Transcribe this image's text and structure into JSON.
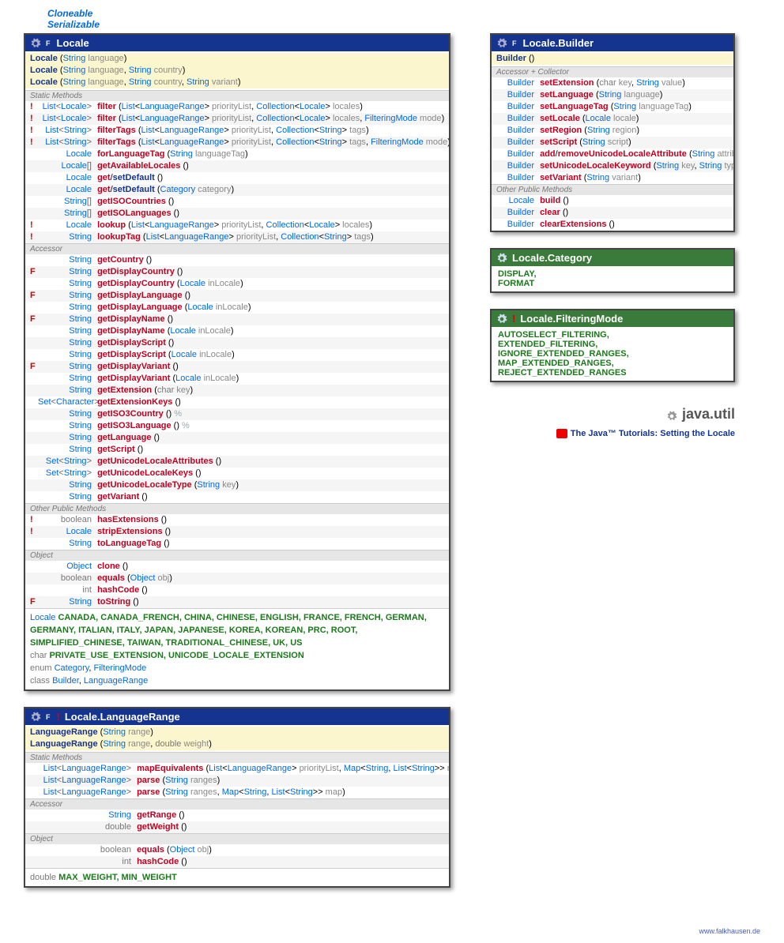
{
  "topLinks": [
    "Cloneable",
    "Serializable"
  ],
  "locale": {
    "title": "Locale",
    "flag": "F",
    "ctors": [
      {
        "html": "<span class='mb'>Locale</span> (<span class='t'>String</span> <span class='p'>language</span>)"
      },
      {
        "html": "<span class='mb'>Locale</span> (<span class='t'>String</span> <span class='p'>language</span>, <span class='t'>String</span> <span class='p'>country</span>)"
      },
      {
        "html": "<span class='mb'>Locale</span> (<span class='t'>String</span> <span class='p'>language</span>, <span class='t'>String</span> <span class='p'>country</span>, <span class='t'>String</span> <span class='p'>variant</span>)"
      }
    ],
    "static": {
      "label": "Static Methods",
      "rows": [
        {
          "mk": "!",
          "ret": "<span class='t'>List</span>&lt;<span class='t'>Locale</span>&gt;",
          "sig": "<span class='m'>filter</span> (<span class='t'>List</span>&lt;<span class='t'>LanguageRange</span>&gt; <span class='p'>priorityList</span>, <span class='t'>Collection</span>&lt;<span class='t'>Locale</span>&gt; <span class='p'>locales</span>)"
        },
        {
          "mk": "!",
          "ret": "<span class='t'>List</span>&lt;<span class='t'>Locale</span>&gt;",
          "sig": "<span class='m'>filter</span> (<span class='t'>List</span>&lt;<span class='t'>LanguageRange</span>&gt; <span class='p'>priorityList</span>, <span class='t'>Collection</span>&lt;<span class='t'>Locale</span>&gt; <span class='p'>locales</span>, <span class='t'>FilteringMode</span> <span class='p'>mode</span>)"
        },
        {
          "mk": "!",
          "ret": "<span class='t'>List</span>&lt;<span class='t'>String</span>&gt;",
          "sig": "<span class='m'>filterTags</span> (<span class='t'>List</span>&lt;<span class='t'>LanguageRange</span>&gt; <span class='p'>priorityList</span>, <span class='t'>Collection</span>&lt;<span class='t'>String</span>&gt; <span class='p'>tags</span>)"
        },
        {
          "mk": "!",
          "ret": "<span class='t'>List</span>&lt;<span class='t'>String</span>&gt;",
          "sig": "<span class='m'>filterTags</span> (<span class='t'>List</span>&lt;<span class='t'>LanguageRange</span>&gt; <span class='p'>priorityList</span>, <span class='t'>Collection</span>&lt;<span class='t'>String</span>&gt; <span class='p'>tags</span>, <span class='t'>FilteringMode</span> <span class='p'>mode</span>)"
        },
        {
          "mk": "",
          "ret": "<span class='t'>Locale</span>",
          "sig": "<span class='m'>forLanguageTag</span> (<span class='t'>String</span> <span class='p'>languageTag</span>)"
        },
        {
          "mk": "",
          "ret": "<span class='t'>Locale</span>[]",
          "sig": "<span class='m'>getAvailableLocales</span> ()"
        },
        {
          "mk": "",
          "ret": "<span class='t'>Locale</span>",
          "sig": "<span class='m'>get</span>/<span class='mb'>setDefault</span> ()"
        },
        {
          "mk": "",
          "ret": "<span class='t'>Locale</span>",
          "sig": "<span class='m'>get</span>/<span class='mb'>setDefault</span> (<span class='t'>Category</span> <span class='p'>category</span>)"
        },
        {
          "mk": "",
          "ret": "<span class='t'>String</span>[]",
          "sig": "<span class='m'>getISOCountries</span> ()"
        },
        {
          "mk": "",
          "ret": "<span class='t'>String</span>[]",
          "sig": "<span class='m'>getISOLanguages</span> ()"
        },
        {
          "mk": "!",
          "ret": "<span class='t'>Locale</span>",
          "sig": "<span class='m'>lookup</span> (<span class='t'>List</span>&lt;<span class='t'>LanguageRange</span>&gt; <span class='p'>priorityList</span>, <span class='t'>Collection</span>&lt;<span class='t'>Locale</span>&gt; <span class='p'>locales</span>)"
        },
        {
          "mk": "!",
          "ret": "<span class='t'>String</span>",
          "sig": "<span class='m'>lookupTag</span> (<span class='t'>List</span>&lt;<span class='t'>LanguageRange</span>&gt; <span class='p'>priorityList</span>, <span class='t'>Collection</span>&lt;<span class='t'>String</span>&gt; <span class='p'>tags</span>)"
        }
      ]
    },
    "accessor": {
      "label": "Accessor",
      "rows": [
        {
          "mk": "",
          "ret": "<span class='t'>String</span>",
          "sig": "<span class='m'>getCountry</span> ()"
        },
        {
          "mk": "F",
          "ret": "<span class='t'>String</span>",
          "sig": "<span class='m'>getDisplayCountry</span> ()"
        },
        {
          "mk": "",
          "ret": "<span class='t'>String</span>",
          "sig": "<span class='m'>getDisplayCountry</span> (<span class='t'>Locale</span> <span class='p'>inLocale</span>)"
        },
        {
          "mk": "F",
          "ret": "<span class='t'>String</span>",
          "sig": "<span class='m'>getDisplayLanguage</span> ()"
        },
        {
          "mk": "",
          "ret": "<span class='t'>String</span>",
          "sig": "<span class='m'>getDisplayLanguage</span> (<span class='t'>Locale</span> <span class='p'>inLocale</span>)"
        },
        {
          "mk": "F",
          "ret": "<span class='t'>String</span>",
          "sig": "<span class='m'>getDisplayName</span> ()"
        },
        {
          "mk": "",
          "ret": "<span class='t'>String</span>",
          "sig": "<span class='m'>getDisplayName</span> (<span class='t'>Locale</span> <span class='p'>inLocale</span>)"
        },
        {
          "mk": "",
          "ret": "<span class='t'>String</span>",
          "sig": "<span class='m'>getDisplayScript</span> ()"
        },
        {
          "mk": "",
          "ret": "<span class='t'>String</span>",
          "sig": "<span class='m'>getDisplayScript</span> (<span class='t'>Locale</span> <span class='p'>inLocale</span>)"
        },
        {
          "mk": "F",
          "ret": "<span class='t'>String</span>",
          "sig": "<span class='m'>getDisplayVariant</span> ()"
        },
        {
          "mk": "",
          "ret": "<span class='t'>String</span>",
          "sig": "<span class='m'>getDisplayVariant</span> (<span class='t'>Locale</span> <span class='p'>inLocale</span>)"
        },
        {
          "mk": "",
          "ret": "<span class='t'>String</span>",
          "sig": "<span class='m'>getExtension</span> (<span class='kw'>char</span> <span class='p'>key</span>)"
        },
        {
          "mk": "",
          "ret": "<span class='t'>Set</span>&lt;<span class='t'>Character</span>&gt;",
          "sig": "<span class='m'>getExtensionKeys</span> ()"
        },
        {
          "mk": "",
          "ret": "<span class='t'>String</span>",
          "sig": "<span class='m'>getISO3Country</span> () <span class='pc'>%</span>"
        },
        {
          "mk": "",
          "ret": "<span class='t'>String</span>",
          "sig": "<span class='m'>getISO3Language</span> () <span class='pc'>%</span>"
        },
        {
          "mk": "",
          "ret": "<span class='t'>String</span>",
          "sig": "<span class='m'>getLanguage</span> ()"
        },
        {
          "mk": "",
          "ret": "<span class='t'>String</span>",
          "sig": "<span class='m'>getScript</span> ()"
        },
        {
          "mk": "",
          "ret": "<span class='t'>Set</span>&lt;<span class='t'>String</span>&gt;",
          "sig": "<span class='m'>getUnicodeLocaleAttributes</span> ()"
        },
        {
          "mk": "",
          "ret": "<span class='t'>Set</span>&lt;<span class='t'>String</span>&gt;",
          "sig": "<span class='m'>getUnicodeLocaleKeys</span> ()"
        },
        {
          "mk": "",
          "ret": "<span class='t'>String</span>",
          "sig": "<span class='m'>getUnicodeLocaleType</span> (<span class='t'>String</span> <span class='p'>key</span>)"
        },
        {
          "mk": "",
          "ret": "<span class='t'>String</span>",
          "sig": "<span class='m'>getVariant</span> ()"
        }
      ]
    },
    "other": {
      "label": "Other Public Methods",
      "rows": [
        {
          "mk": "!",
          "ret": "<span class='kw'>boolean</span>",
          "sig": "<span class='m'>hasExtensions</span> ()"
        },
        {
          "mk": "!",
          "ret": "<span class='t'>Locale</span>",
          "sig": "<span class='m'>stripExtensions</span> ()"
        },
        {
          "mk": "",
          "ret": "<span class='t'>String</span>",
          "sig": "<span class='m'>toLanguageTag</span> ()"
        }
      ]
    },
    "object": {
      "label": "Object",
      "rows": [
        {
          "mk": "",
          "ret": "<span class='t'>Object</span>",
          "sig": "<span class='m'>clone</span> ()"
        },
        {
          "mk": "",
          "ret": "<span class='kw'>boolean</span>",
          "sig": "<span class='m'>equals</span> (<span class='t'>Object</span> <span class='p'>obj</span>)"
        },
        {
          "mk": "",
          "ret": "<span class='kw'>int</span>",
          "sig": "<span class='m'>hashCode</span> ()"
        },
        {
          "mk": "F",
          "ret": "<span class='t'>String</span>",
          "sig": "<span class='m'>toString</span> ()"
        }
      ]
    },
    "fields": [
      "<span class='t'>Locale</span> <span class='green'>CANADA, CANADA_FRENCH, CHINA, CHINESE, ENGLISH, FRANCE, FRENCH, GERMAN, GERMANY, ITALIAN, ITALY, JAPAN, JAPANESE, KOREA, KOREAN, PRC, ROOT, SIMPLIFIED_CHINESE, TAIWAN, TRADITIONAL_CHINESE, UK, US</span>",
      "<span class='kw'>char</span> <span class='green'>PRIVATE_USE_EXTENSION, UNICODE_LOCALE_EXTENSION</span>",
      "<span class='kw'>enum</span> <span class='t'>Category</span>, <span class='t'>FilteringMode</span>",
      "<span class='kw'>class</span> <span class='t'>Builder</span>, <span class='t'>LanguageRange</span>"
    ]
  },
  "langRange": {
    "title": "Locale.LanguageRange",
    "flag": "F",
    "bang": "!",
    "ctors": [
      {
        "html": "<span class='mb'>LanguageRange</span> (<span class='t'>String</span> <span class='p'>range</span>)"
      },
      {
        "html": "<span class='mb'>LanguageRange</span> (<span class='t'>String</span> <span class='p'>range</span>, <span class='kw'>double</span> <span class='p'>weight</span>)"
      }
    ],
    "static": {
      "label": "Static Methods",
      "rows": [
        {
          "ret": "<span class='t'>List</span>&lt;<span class='t'>LanguageRange</span>&gt;",
          "sig": "<span class='m'>mapEquivalents</span> (<span class='t'>List</span>&lt;<span class='t'>LanguageRange</span>&gt; <span class='p'>priorityList</span>, <span class='t'>Map</span>&lt;<span class='t'>String</span>, <span class='t'>List</span>&lt;<span class='t'>String</span>&gt;&gt; <span class='p'>map</span>)"
        },
        {
          "ret": "<span class='t'>List</span>&lt;<span class='t'>LanguageRange</span>&gt;",
          "sig": "<span class='m'>parse</span> (<span class='t'>String</span> <span class='p'>ranges</span>)"
        },
        {
          "ret": "<span class='t'>List</span>&lt;<span class='t'>LanguageRange</span>&gt;",
          "sig": "<span class='m'>parse</span> (<span class='t'>String</span> <span class='p'>ranges</span>, <span class='t'>Map</span>&lt;<span class='t'>String</span>, <span class='t'>List</span>&lt;<span class='t'>String</span>&gt;&gt; <span class='p'>map</span>)"
        }
      ]
    },
    "accessor": {
      "label": "Accessor",
      "rows": [
        {
          "ret": "<span class='t'>String</span>",
          "sig": "<span class='m'>getRange</span> ()"
        },
        {
          "ret": "<span class='kw'>double</span>",
          "sig": "<span class='m'>getWeight</span> ()"
        }
      ]
    },
    "object": {
      "label": "Object",
      "rows": [
        {
          "ret": "<span class='kw'>boolean</span>",
          "sig": "<span class='m'>equals</span> (<span class='t'>Object</span> <span class='p'>obj</span>)"
        },
        {
          "ret": "<span class='kw'>int</span>",
          "sig": "<span class='m'>hashCode</span> ()"
        }
      ]
    },
    "fields": [
      "<span class='kw'>double</span> <span class='green'>MAX_WEIGHT, MIN_WEIGHT</span>"
    ]
  },
  "builder": {
    "title": "Locale.Builder",
    "flag": "F",
    "ctors": [
      {
        "html": "<span class='mb'>Builder</span> ()"
      }
    ],
    "ac": {
      "label": "Accessor + Collector",
      "rows": [
        {
          "ret": "<span class='t'>Builder</span>",
          "sig": "<span class='m'>setExtension</span> (<span class='kw'>char</span> <span class='p'>key</span>, <span class='t'>String</span> <span class='p'>value</span>)"
        },
        {
          "ret": "<span class='t'>Builder</span>",
          "sig": "<span class='m'>setLanguage</span> (<span class='t'>String</span> <span class='p'>language</span>)"
        },
        {
          "ret": "<span class='t'>Builder</span>",
          "sig": "<span class='m'>setLanguageTag</span> (<span class='t'>String</span> <span class='p'>languageTag</span>)"
        },
        {
          "ret": "<span class='t'>Builder</span>",
          "sig": "<span class='m'>setLocale</span> (<span class='t'>Locale</span> <span class='p'>locale</span>)"
        },
        {
          "ret": "<span class='t'>Builder</span>",
          "sig": "<span class='m'>setRegion</span> (<span class='t'>String</span> <span class='p'>region</span>)"
        },
        {
          "ret": "<span class='t'>Builder</span>",
          "sig": "<span class='m'>setScript</span> (<span class='t'>String</span> <span class='p'>script</span>)"
        },
        {
          "ret": "<span class='t'>Builder</span>",
          "sig": "<span class='m'>add</span>/<span class='m'>removeUnicodeLocaleAttribute</span> (<span class='t'>String</span> <span class='p'>attribute</span>)"
        },
        {
          "ret": "<span class='t'>Builder</span>",
          "sig": "<span class='m'>setUnicodeLocaleKeyword</span> (<span class='t'>String</span> <span class='p'>key</span>, <span class='t'>String</span> <span class='p'>type</span>)"
        },
        {
          "ret": "<span class='t'>Builder</span>",
          "sig": "<span class='m'>setVariant</span> (<span class='t'>String</span> <span class='p'>variant</span>)"
        }
      ]
    },
    "other": {
      "label": "Other Public Methods",
      "rows": [
        {
          "ret": "<span class='t'>Locale</span>",
          "sig": "<span class='m'>build</span> ()"
        },
        {
          "ret": "<span class='t'>Builder</span>",
          "sig": "<span class='m'>clear</span> ()"
        },
        {
          "ret": "<span class='t'>Builder</span>",
          "sig": "<span class='m'>clearExtensions</span> ()"
        }
      ]
    }
  },
  "category": {
    "title": "Locale.Category",
    "values": "DISPLAY,<br>FORMAT"
  },
  "filtering": {
    "title": "Locale.FilteringMode",
    "bang": "!",
    "values": "AUTOSELECT_FILTERING,<br>EXTENDED_FILTERING,<br>IGNORE_EXTENDED_RANGES,<br>MAP_EXTENDED_RANGES,<br>REJECT_EXTENDED_RANGES"
  },
  "pkg": "java.util",
  "tutorial": "The Java™ Tutorials: Setting the Locale",
  "credit": "www.falkhausen.de"
}
